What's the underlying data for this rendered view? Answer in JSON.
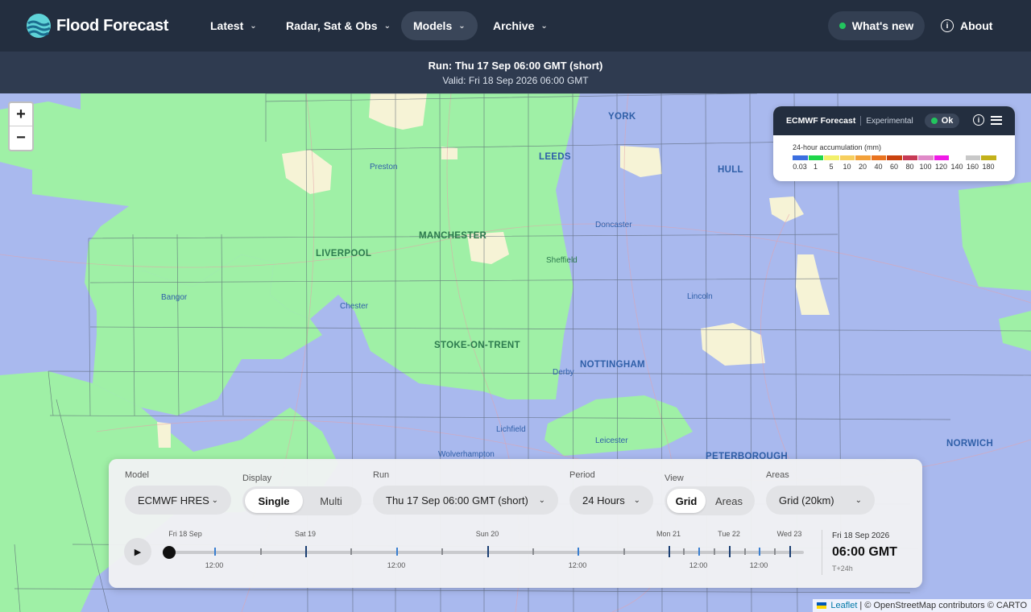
{
  "nav": {
    "logo_text": "Flood Forecast",
    "items": [
      {
        "label": "Latest",
        "active": false
      },
      {
        "label": "Radar, Sat & Obs",
        "active": false
      },
      {
        "label": "Models",
        "active": true
      },
      {
        "label": "Archive",
        "active": false
      }
    ],
    "whats_new": "What's new",
    "about": "About"
  },
  "run_bar": {
    "run": "Run: Thu 17 Sep 06:00 GMT (short)",
    "valid": "Valid: Fri 18 Sep 2026 06:00 GMT"
  },
  "map": {
    "zoom_in": "+",
    "zoom_out": "−",
    "places": {
      "york": "YORK",
      "leeds": "LEEDS",
      "hull": "HULL",
      "preston": "Preston",
      "doncaster": "Doncaster",
      "manchester": "MANCHESTER",
      "liverpool": "LIVERPOOL",
      "sheffield": "Sheffield",
      "bangor": "Bangor",
      "chester": "Chester",
      "lincoln": "Lincoln",
      "stoke": "STOKE-ON-TRENT",
      "derby": "Derby",
      "nottingham": "NOTTINGHAM",
      "lichfield": "Lichfield",
      "leicester": "Leicester",
      "wolverhampton": "Wolverhampton",
      "peterborough": "PETERBOROUGH",
      "norwich": "NORWICH"
    },
    "attribution": {
      "leaflet": "Leaflet",
      "rest": "| © OpenStreetMap contributors © CARTO"
    }
  },
  "legend": {
    "title": "ECMWF Forecast",
    "tag": "Experimental",
    "status": "Ok",
    "subtitle": "24-hour accumulation (mm)",
    "colors": [
      "#3b6fe0",
      "#1fd64a",
      "#f2f06a",
      "#f7cf5e",
      "#f3a13a",
      "#e9731f",
      "#c9420f",
      "#c73a55",
      "#e08ac8",
      "#f01ae6",
      "#ffffff",
      "#c8c8c8",
      "#c3b11a"
    ],
    "labels": [
      "0.03",
      "1",
      "5",
      "10",
      "20",
      "40",
      "60",
      "80",
      "100",
      "120",
      "140",
      "160",
      "180"
    ]
  },
  "controls": {
    "model": {
      "label": "Model",
      "value": "ECMWF HRES"
    },
    "display": {
      "label": "Display",
      "options": [
        "Single",
        "Multi"
      ],
      "selected": "Single"
    },
    "run": {
      "label": "Run",
      "value": "Thu 17 Sep 06:00 GMT (short)"
    },
    "period": {
      "label": "Period",
      "value": "24 Hours"
    },
    "view": {
      "label": "View",
      "options": [
        "Grid",
        "Areas"
      ],
      "selected": "Grid"
    },
    "areas": {
      "label": "Areas",
      "value": "Grid (20km)"
    }
  },
  "timeline": {
    "days": [
      "Fri 18 Sep",
      "Sat 19",
      "Sun 20",
      "Mon 21",
      "Tue 22",
      "Wed 23"
    ],
    "hour_labels": [
      "12:00",
      "12:00",
      "12:00",
      "12:00",
      "12:00"
    ],
    "progress": 0,
    "current_date": "Fri 18 Sep 2026",
    "current_time": "06:00 GMT",
    "offset": "T+24h"
  }
}
